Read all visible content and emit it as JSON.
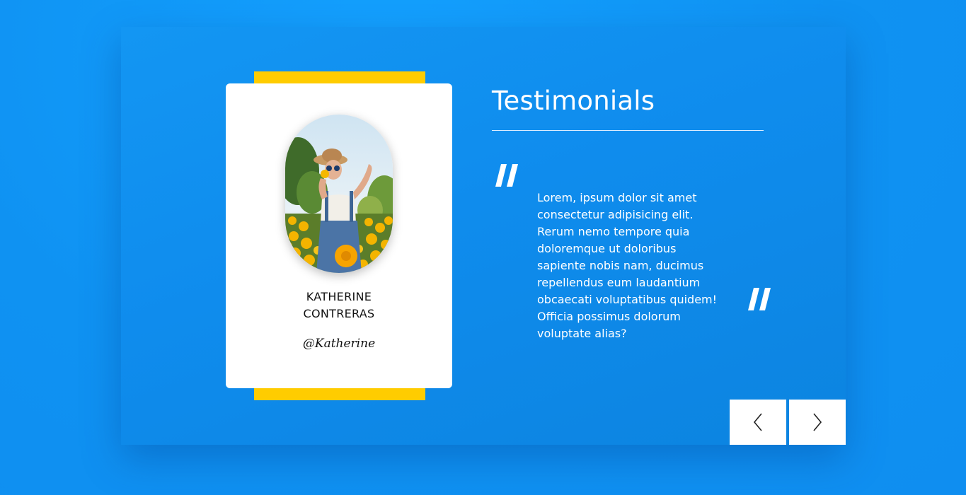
{
  "testimonial": {
    "title": "Testimonials",
    "name_line1": "KATHERINE",
    "name_line2": "CONTRERAS",
    "handle": "@Katherine",
    "quote": "Lorem, ipsum dolor sit amet consectetur adipisicing elit. Rerum nemo tempore quia doloremque ut doloribus sapiente nobis nam, ducimus repellendus eum laudantium obcaecati voluptatibus quidem! Officia possimus dolorum voluptate alias?"
  },
  "navigation": {
    "prev_icon": "chevron-left-icon",
    "next_icon": "chevron-right-icon"
  },
  "colors": {
    "background": "#1193f2",
    "accent_bar": "#ffcc00",
    "card": "#ffffff",
    "text_light": "#ffffff",
    "text_dark": "#111111"
  }
}
